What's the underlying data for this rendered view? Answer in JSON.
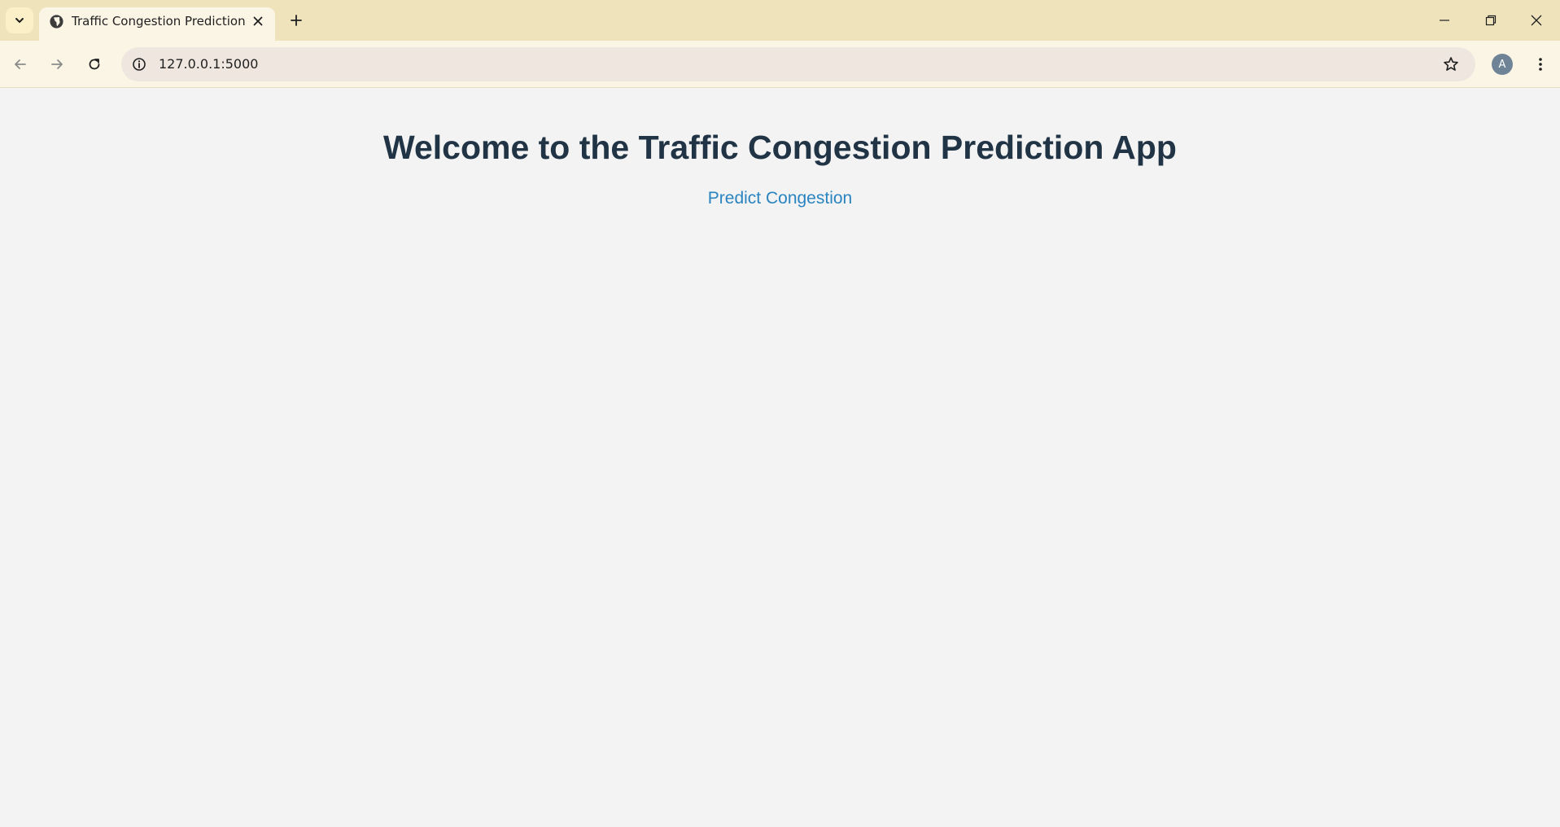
{
  "browser": {
    "tab": {
      "title": "Traffic Congestion Prediction",
      "favicon": "globe-icon"
    },
    "address_bar": {
      "url": "127.0.0.1:5000"
    },
    "profile_initial": "A"
  },
  "page": {
    "heading": "Welcome to the Traffic Congestion Prediction App",
    "predict_link": "Predict Congestion"
  },
  "colors": {
    "heading": "#203446",
    "link": "#2a84c0",
    "background": "#f3f3f3",
    "tabstrip": "#efe3bb"
  }
}
